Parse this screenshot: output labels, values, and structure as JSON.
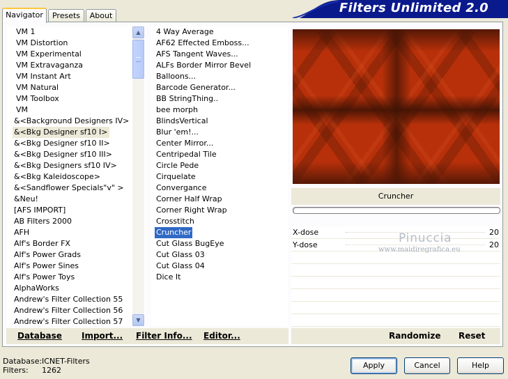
{
  "header": {
    "title": "Filters Unlimited 2.0"
  },
  "tabs": [
    {
      "label": "Navigator",
      "active": true
    },
    {
      "label": "Presets",
      "active": false
    },
    {
      "label": "About",
      "active": false
    }
  ],
  "navigator": {
    "items": [
      "VM 1",
      "VM Distortion",
      "VM Experimental",
      "VM Extravaganza",
      "VM Instant Art",
      "VM Natural",
      "VM Toolbox",
      "VM",
      "&<Background Designers IV>",
      "&<Bkg Designer sf10 I>",
      "&<Bkg Designer sf10 II>",
      "&<Bkg Designer sf10 III>",
      "&<Bkg Designers sf10 IV>",
      "&<Bkg Kaleidoscope>",
      "&<Sandflower Specials\"v\" >",
      "&Neu!",
      "[AFS IMPORT]",
      "AB Filters 2000",
      "AFH",
      "Alf's Border FX",
      "Alf's Power Grads",
      "Alf's Power Sines",
      "Alf's Power Toys",
      "AlphaWorks",
      "Andrew's Filter Collection 55",
      "Andrew's Filter Collection 56",
      "Andrew's Filter Collection 57"
    ],
    "highlighted_index": 9
  },
  "filters": {
    "items": [
      "4 Way Average",
      "AF62 Effected Emboss...",
      "AFS Tangent Waves...",
      "ALFs Border Mirror Bevel",
      "Balloons...",
      "Barcode Generator...",
      "BB StringThing..",
      "bee morph",
      "BlindsVertical",
      "Blur 'em!...",
      "Center Mirror...",
      "Centripedal Tile",
      "Circle Pede",
      "Cirquelate",
      "Convergance",
      "Corner Half Wrap",
      "Corner Right Wrap",
      "Crosstitch",
      "Cruncher",
      "Cut Glass  BugEye",
      "Cut Glass 03",
      "Cut Glass 04",
      "Dice It"
    ],
    "selected_index": 18
  },
  "preview": {
    "filter_name": "Cruncher",
    "colors": {
      "base": "#b8300a",
      "dark": "#3a1204"
    }
  },
  "params": [
    {
      "name": "X-dose",
      "value": "20"
    },
    {
      "name": "Y-dose",
      "value": "20"
    }
  ],
  "watermark": {
    "line1": "Pinuccia",
    "line2": "www.maidiregrafica.eu"
  },
  "bottom_bar": {
    "database": "Database",
    "import": "Import...",
    "filter_info": "Filter Info...",
    "editor": "Editor...",
    "randomize": "Randomize",
    "reset": "Reset"
  },
  "footer": {
    "database_label": "Database:",
    "database_value": "ICNET-Filters",
    "filters_label": "Filters:",
    "filters_value": "1262"
  },
  "buttons": {
    "apply": "Apply",
    "cancel": "Cancel",
    "help": "Help"
  },
  "scrollbar": {
    "up_icon": "▲",
    "down_icon": "▼"
  }
}
